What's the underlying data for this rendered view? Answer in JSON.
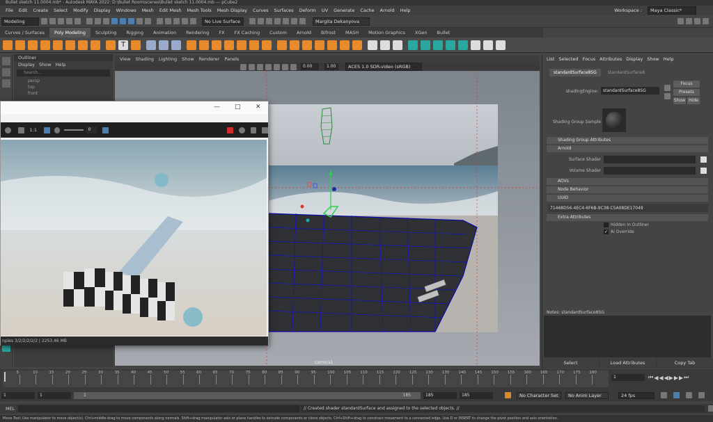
{
  "window": {
    "title": "Bullet sketch 11.0004.mb* - Autodesk MAYA 2022: D:\\Bullet Room\\scenes\\Bullet sketch 11.0004.mb  ---  pCube2"
  },
  "menubar": [
    "File",
    "Edit",
    "Create",
    "Select",
    "Modify",
    "Display",
    "Windows",
    "Mesh",
    "Edit Mesh",
    "Mesh Tools",
    "Mesh Display",
    "Curves",
    "Surfaces",
    "Deform",
    "UV",
    "Generate",
    "Cache",
    "Arnold",
    "Help"
  ],
  "workspace": {
    "label": "Workspace :",
    "value": "Maya Classic*"
  },
  "toolbar": {
    "mode": "Modeling",
    "live_surface": "No Live Surface",
    "user": "Margita Dekanyova"
  },
  "shelf_tabs": [
    "Curves / Surfaces",
    "Poly Modeling",
    "Sculpting",
    "Rigging",
    "Animation",
    "Rendering",
    "FX",
    "FX Caching",
    "Custom",
    "Arnold",
    "Bifrost",
    "MASH",
    "Motion Graphics",
    "XGen",
    "Bullet"
  ],
  "shelf_active": "Poly Modeling",
  "outliner": {
    "title": "Outliner",
    "menu": [
      "Display",
      "Show",
      "Help"
    ],
    "search_placeholder": "Search...",
    "items": [
      "persp",
      "top",
      "front"
    ]
  },
  "viewport": {
    "menu": [
      "View",
      "Shading",
      "Lighting",
      "Show",
      "Renderer",
      "Panels"
    ],
    "exposure": "0.00",
    "gamma": "1.00",
    "color_space": "ACES 1.0 SDR-video (sRGB)",
    "camera_label": "camera1"
  },
  "float_window": {
    "ratio": "1:1",
    "exposure": "0",
    "status": "nples 3/2/2/2/2/2 | 2253.46 MB"
  },
  "attribute_editor": {
    "menu": [
      "List",
      "Selected",
      "Focus",
      "Attributes",
      "Display",
      "Show",
      "Help"
    ],
    "tabs": [
      "standardSurface8SG",
      "standardSurface8"
    ],
    "shading_engine_label": "shadingEngine:",
    "shading_engine_value": "standardSurface8SG",
    "focus": "Focus",
    "presets": "Presets",
    "show": "Show",
    "hide": "Hide",
    "sample_label": "Shading Group Sample",
    "sections": {
      "sg_attrs": "Shading Group Attributes",
      "arnold": "Arnold",
      "aovs": "AOVs",
      "node_behavior": "Node Behavior",
      "uuid": "UUID",
      "extra": "Extra Attributes"
    },
    "surface_shader": "Surface Shader",
    "volume_shader": "Volume Shader",
    "uuid_value": "71468D56-4EC4-6F6B-9C38-C5A08DE17049",
    "hidden_in_outliner": "Hidden In Outliner",
    "ai_override": "Ai Override",
    "notes": "Notes:  standardSurface8SG",
    "footer": [
      "Select",
      "Load Attributes",
      "Copy Tab"
    ]
  },
  "timeline": {
    "ticks": [
      "5",
      "10",
      "15",
      "20",
      "25",
      "30",
      "35",
      "40",
      "45",
      "50",
      "55",
      "60",
      "65",
      "70",
      "75",
      "80",
      "85",
      "90",
      "95",
      "100",
      "105",
      "110",
      "115",
      "120",
      "125",
      "130",
      "135",
      "140",
      "145",
      "150",
      "155",
      "160",
      "165",
      "170",
      "175",
      "180"
    ],
    "current_frame": "1"
  },
  "range": {
    "start": "1",
    "start2": "1",
    "slider_start": "1",
    "slider_end": "185",
    "end": "185",
    "end2": "185",
    "character_set": "No Character Set",
    "anim_layer": "No Anim Layer",
    "fps": "24 fps"
  },
  "cmdline": {
    "label": "MEL",
    "result": "// Created shader standardSurface and assigned to the selected objects. //"
  },
  "helpline": "Move Tool: Use manipulator to move object(s). Ctrl+middle-drag to move components along normals. Shift+drag manipulator axis or plane handles to extrude components or clone objects. Ctrl+Shift+drag to constrain movement to a connected edge. Use D or INSERT to change the pivot position and axis orientation."
}
